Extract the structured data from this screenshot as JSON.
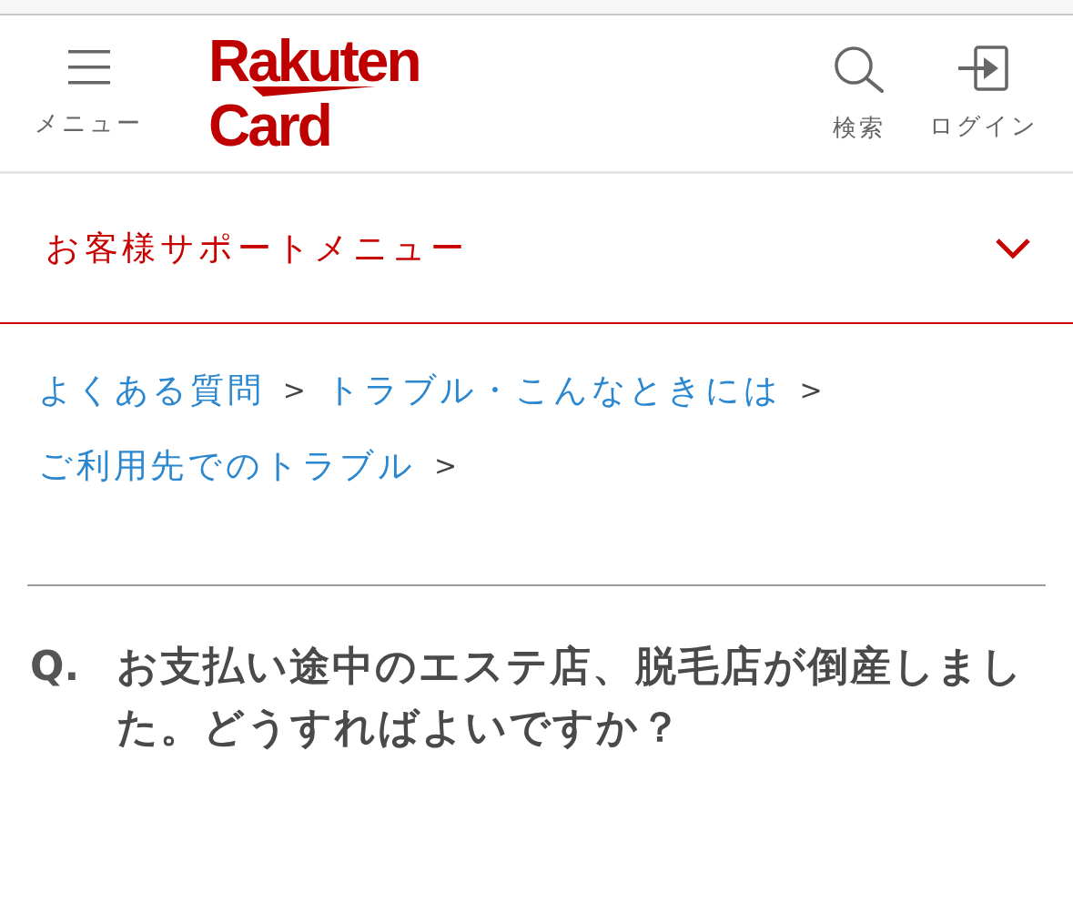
{
  "header": {
    "menu_button": {
      "label": "メニュー"
    },
    "logo": {
      "line_1": "Rakuten",
      "line_2": "Card"
    },
    "actions": [
      {
        "kind": "search",
        "label": "検索"
      },
      {
        "kind": "login",
        "label": "ログイン"
      }
    ]
  },
  "support_menu": {
    "label": "お客様サポートメニュー",
    "expanded": false
  },
  "breadcrumbs": [
    {
      "label": "よくある質問",
      "separator": ">"
    },
    {
      "label": "トラブル・こんなときには",
      "separator": ">"
    },
    {
      "label": "ご利用先でのトラブル",
      "separator": ">"
    }
  ],
  "question": {
    "marker": "Q.",
    "text": "お支払い途中のエステ店、脱毛店が倒産しました。どうすればよいですか？"
  }
}
